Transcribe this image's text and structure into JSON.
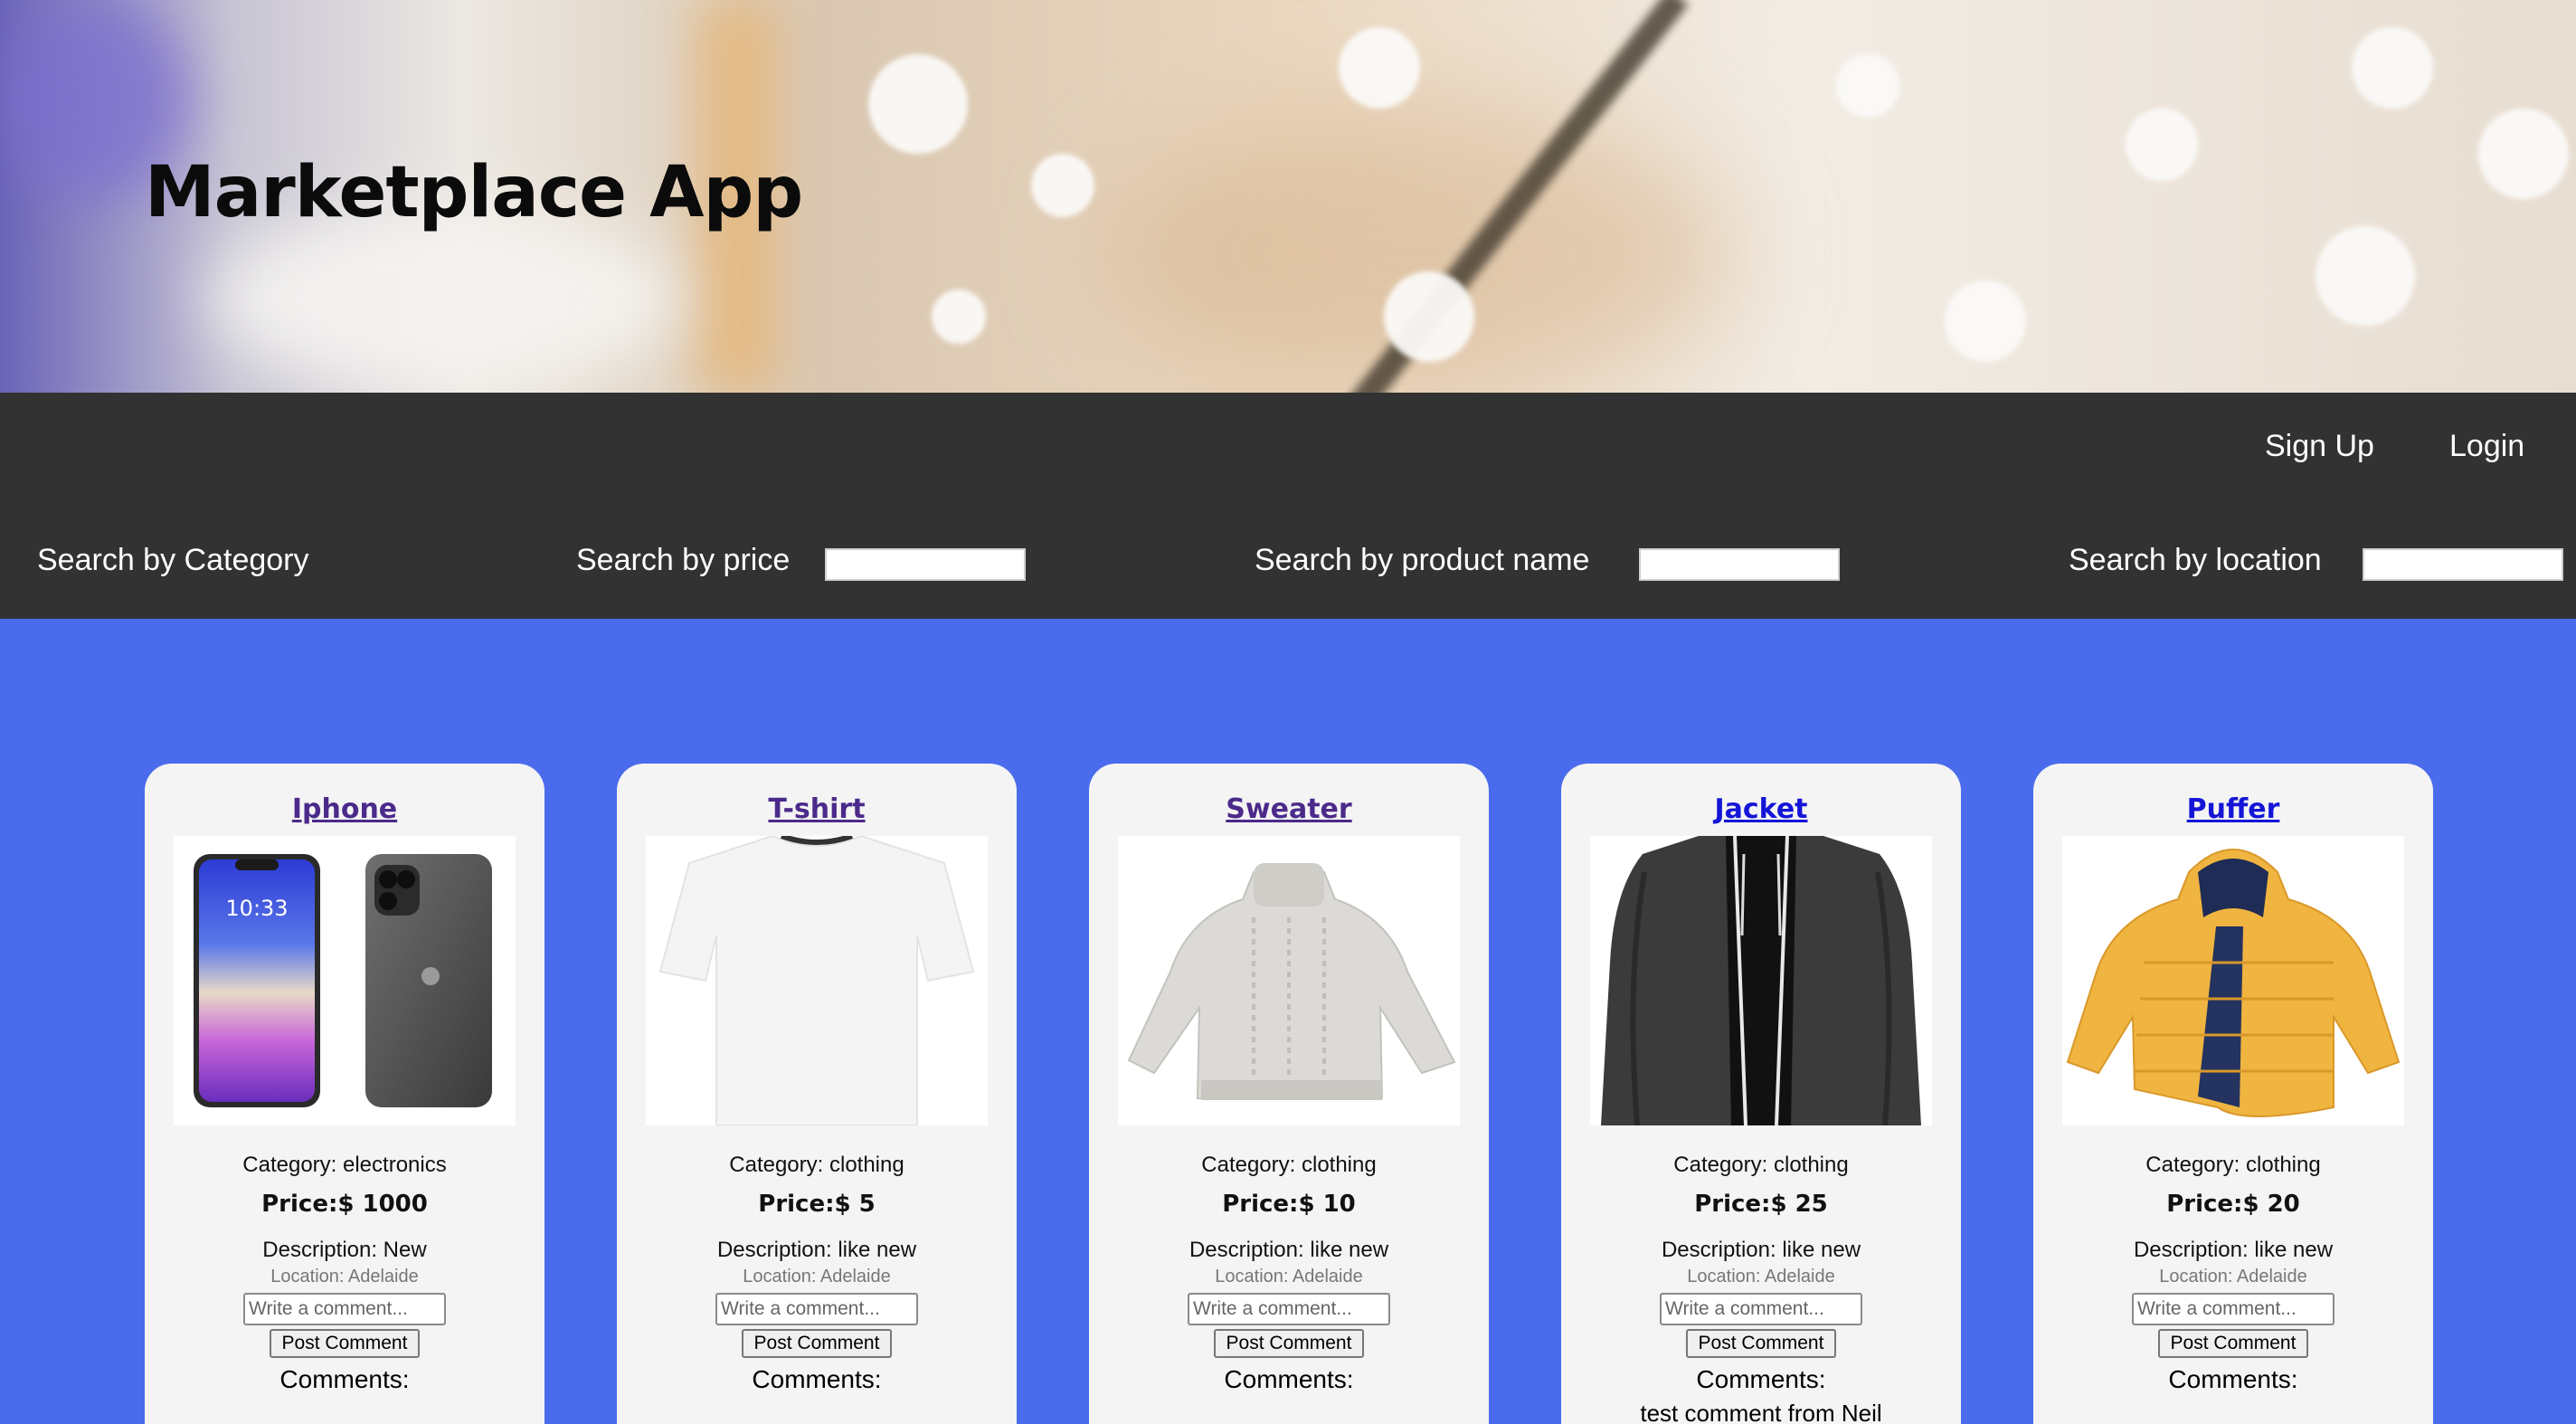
{
  "hero": {
    "title": "Marketplace App"
  },
  "nav": {
    "signup_label": "Sign Up",
    "login_label": "Login"
  },
  "search": {
    "category_label": "Search by Category",
    "price_label": "Search by price",
    "name_label": "Search by product name",
    "location_label": "Search by location"
  },
  "colors": {
    "page_background": "#4a6cec",
    "nav_background": "#323232",
    "card_background": "#f4f4f4",
    "visited_link": "#4b2a8a",
    "link": "#1515d8"
  },
  "products": [
    {
      "title": "Iphone",
      "image_icon": "iphone-image",
      "category": "Category: electronics",
      "price": "Price:$ 1000",
      "description": "Description: New",
      "location": "Location: Adelaide",
      "comment_placeholder": "Write a comment...",
      "post_label": "Post Comment",
      "comments_label": "Comments:",
      "comments": []
    },
    {
      "title": "T-shirt",
      "image_icon": "tshirt-image",
      "category": "Category: clothing",
      "price": "Price:$ 5",
      "description": "Description: like new",
      "location": "Location: Adelaide",
      "comment_placeholder": "Write a comment...",
      "post_label": "Post Comment",
      "comments_label": "Comments:",
      "comments": []
    },
    {
      "title": "Sweater",
      "image_icon": "sweater-image",
      "category": "Category: clothing",
      "price": "Price:$ 10",
      "description": "Description: like new",
      "location": "Location: Adelaide",
      "comment_placeholder": "Write a comment...",
      "post_label": "Post Comment",
      "comments_label": "Comments:",
      "comments": []
    },
    {
      "title": "Jacket",
      "image_icon": "jacket-image",
      "category": "Category: clothing",
      "price": "Price:$ 25",
      "description": "Description: like new",
      "location": "Location: Adelaide",
      "comment_placeholder": "Write a comment...",
      "post_label": "Post Comment",
      "comments_label": "Comments:",
      "comments": [
        "test comment from Neil"
      ]
    },
    {
      "title": "Puffer",
      "image_icon": "puffer-image",
      "category": "Category: clothing",
      "price": "Price:$ 20",
      "description": "Description: like new",
      "location": "Location: Adelaide",
      "comment_placeholder": "Write a comment...",
      "post_label": "Post Comment",
      "comments_label": "Comments:",
      "comments": []
    }
  ]
}
